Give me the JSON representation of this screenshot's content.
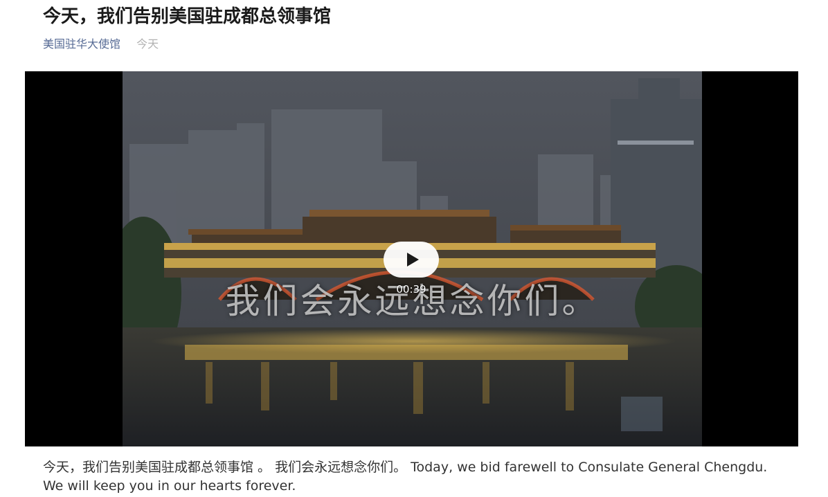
{
  "article": {
    "title": "今天，我们告别美国驻成都总领事馆",
    "account_name": "美国驻华大使馆",
    "publish_date": "今天"
  },
  "video": {
    "overlay_caption": "我们会永远想念你们。",
    "duration": "00:39",
    "play_icon": "play-icon"
  },
  "content": {
    "paragraph": "今天，我们告别美国驻成都总领事馆 。 我们会永远想念你们。 Today, we bid farewell to Consulate General Chengdu. We will keep you in our hearts forever."
  },
  "colors": {
    "account_link": "#576b95",
    "date_text": "#b2b2b2",
    "title_text": "#1a1a1a",
    "body_text": "#333333"
  }
}
